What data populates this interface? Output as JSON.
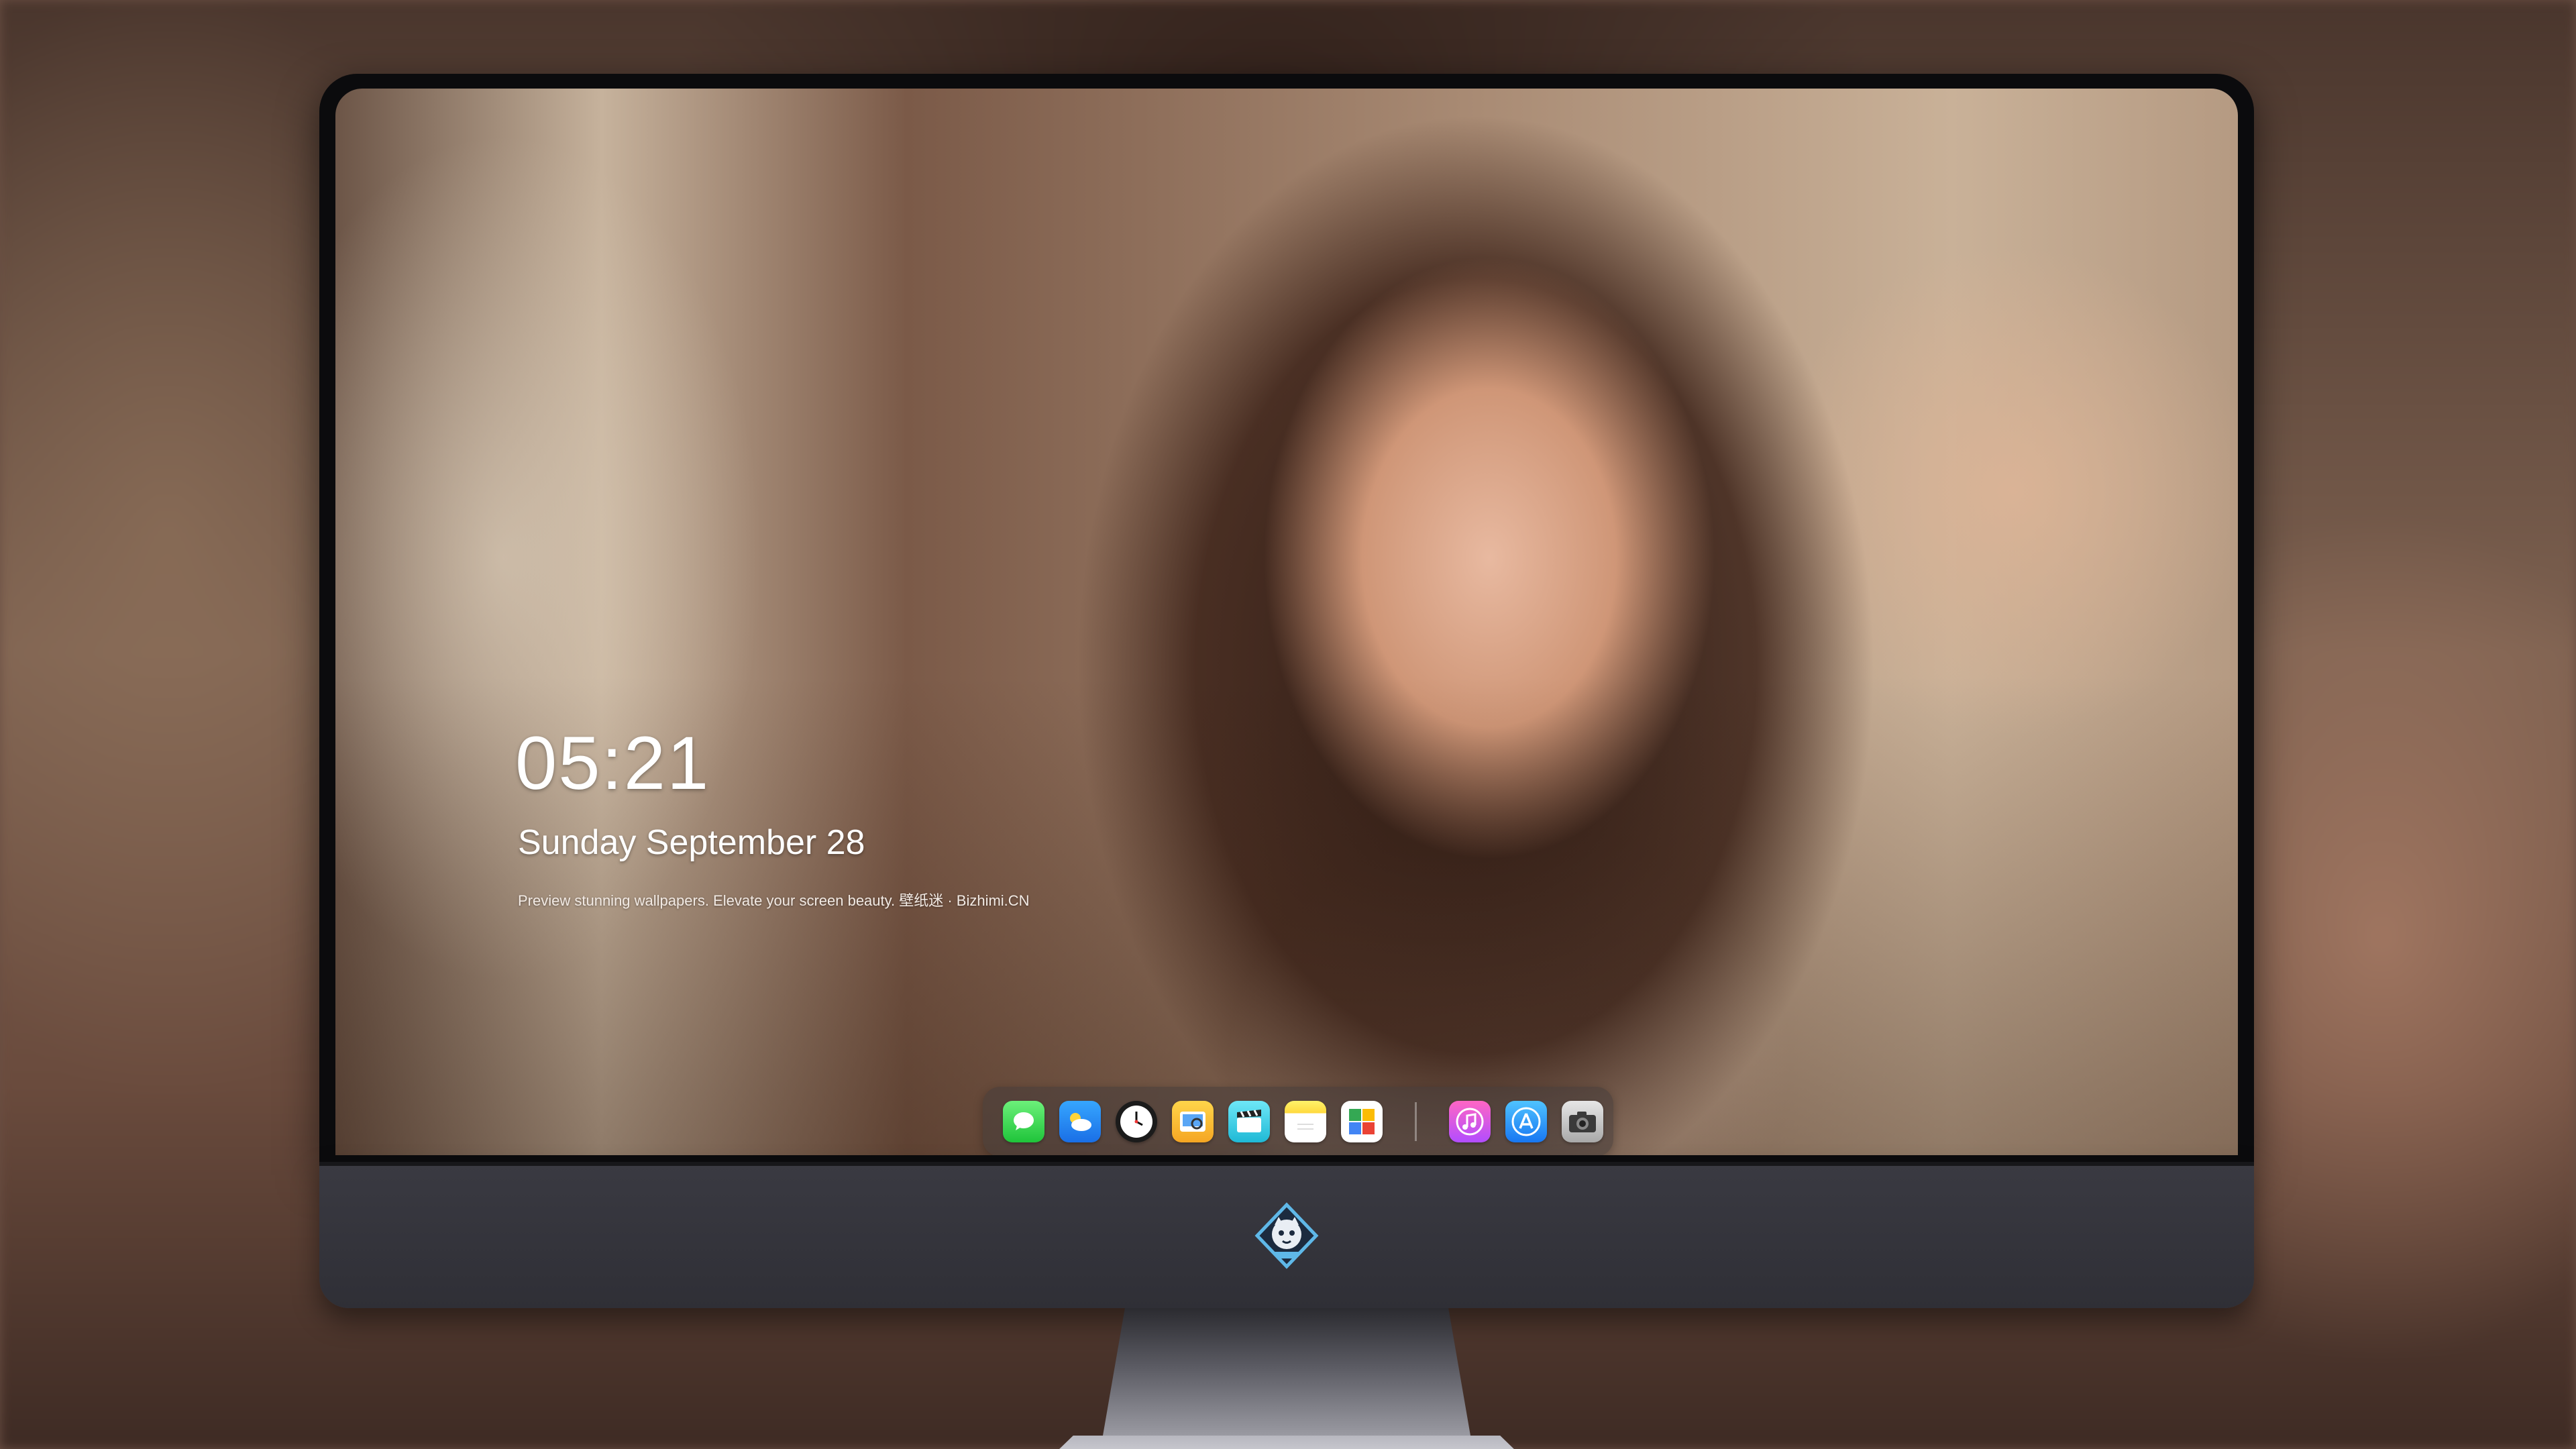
{
  "lockscreen": {
    "time": "05:21",
    "date": "Sunday September  28",
    "caption": "Preview stunning wallpapers. Elevate your screen beauty. 壁纸迷 · Bizhimi.CN"
  },
  "dock": {
    "apps": [
      {
        "name": "messages",
        "glyph": "💬"
      },
      {
        "name": "weather",
        "glyph": "☁"
      },
      {
        "name": "clock",
        "glyph": "🕐"
      },
      {
        "name": "preview",
        "glyph": "🖼"
      },
      {
        "name": "video",
        "glyph": "🎬"
      },
      {
        "name": "notes",
        "glyph": ""
      },
      {
        "name": "photos",
        "glyph": "▦"
      },
      {
        "name": "music",
        "glyph": "♫"
      },
      {
        "name": "app-store",
        "glyph": "A"
      },
      {
        "name": "camera",
        "glyph": "📷"
      }
    ]
  },
  "colors": {
    "bezel": "#0b0b0d",
    "chin": "#3a3a42",
    "text": "#ffffff"
  }
}
